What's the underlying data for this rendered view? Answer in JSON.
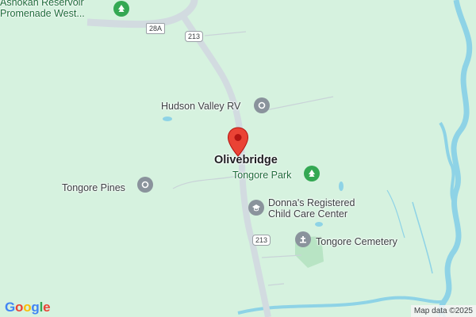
{
  "map": {
    "background_color": "#d6f2df",
    "water_color": "#8ed3e6",
    "road_color": "#d2dbe0",
    "pin_color": "#ea4335"
  },
  "labels": {
    "ashokan_line1": "Ashokan Reservoir",
    "ashokan_line2": "Promenade West...",
    "hudson_valley_rv": "Hudson Valley RV",
    "olivebridge": "Olivebridge",
    "tongore_park": "Tongore Park",
    "tongore_pines": "Tongore Pines",
    "donnas_line1": "Donna's Registered",
    "donnas_line2": "Child Care Center",
    "tongore_cemetery": "Tongore Cemetery"
  },
  "road_shields": {
    "route_28a": "28A",
    "route_213_north": "213",
    "route_213_south": "213"
  },
  "icons": {
    "ashokan": "park-tree-icon",
    "hudson_valley_rv": "place-dot-icon",
    "tongore_park": "park-tree-icon",
    "tongore_pines": "place-dot-icon",
    "donnas": "school-icon",
    "tongore_cemetery": "cemetery-icon",
    "selected": "location-pin-icon"
  },
  "footer": {
    "logo": "Google",
    "attribution": "Map data ©2025"
  }
}
